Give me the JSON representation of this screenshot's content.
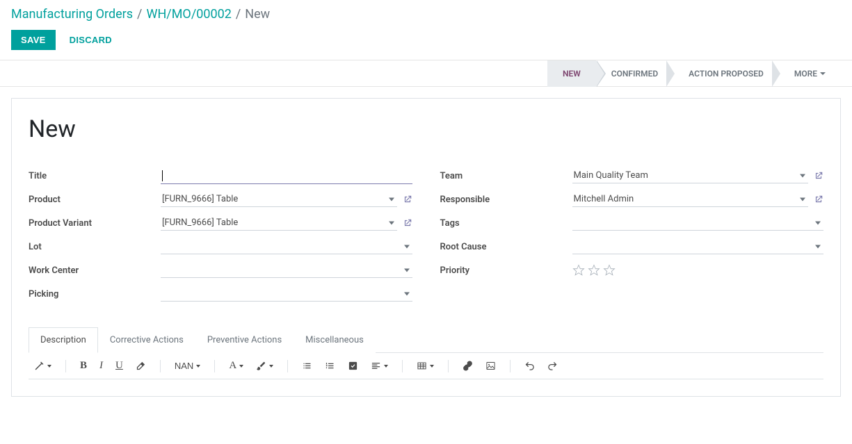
{
  "breadcrumb": {
    "root": "Manufacturing Orders",
    "parent": "WH/MO/00002",
    "current": "New"
  },
  "actions": {
    "save": "SAVE",
    "discard": "DISCARD"
  },
  "statusbar": {
    "stages": [
      "NEW",
      "CONFIRMED",
      "ACTION PROPOSED"
    ],
    "more": "MORE"
  },
  "header": {
    "title": "New"
  },
  "fields_left": {
    "title": {
      "label": "Title",
      "value": ""
    },
    "product": {
      "label": "Product",
      "value": "[FURN_9666] Table"
    },
    "variant": {
      "label": "Product Variant",
      "value": "[FURN_9666] Table"
    },
    "lot": {
      "label": "Lot",
      "value": ""
    },
    "workcenter": {
      "label": "Work Center",
      "value": ""
    },
    "picking": {
      "label": "Picking",
      "value": ""
    }
  },
  "fields_right": {
    "team": {
      "label": "Team",
      "value": "Main Quality Team"
    },
    "responsible": {
      "label": "Responsible",
      "value": "Mitchell Admin"
    },
    "tags": {
      "label": "Tags",
      "value": ""
    },
    "rootcause": {
      "label": "Root Cause",
      "value": ""
    },
    "priority": {
      "label": "Priority"
    }
  },
  "tabs": [
    "Description",
    "Corrective Actions",
    "Preventive Actions",
    "Miscellaneous"
  ],
  "toolbar": {
    "nan": "NAN"
  }
}
